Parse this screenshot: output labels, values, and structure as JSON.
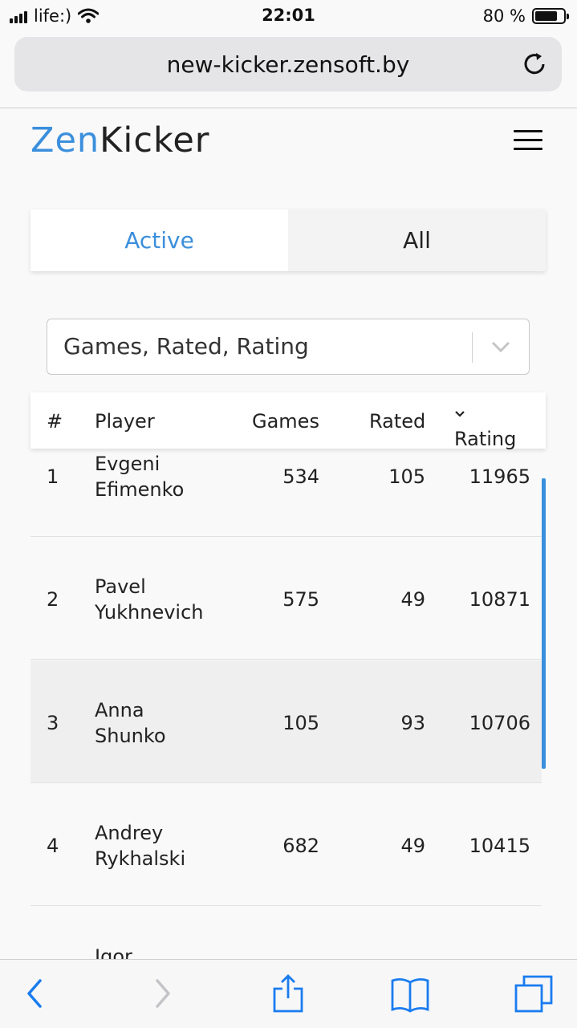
{
  "status_bar": {
    "carrier": "life:)",
    "time": "22:01",
    "battery": "80 %",
    "battery_level": 0.8
  },
  "browser": {
    "url": "new-kicker.zensoft.by"
  },
  "header": {
    "logo_part1": "Zen",
    "logo_part2": "Kicker"
  },
  "tabs": [
    {
      "label": "Active",
      "selected": true
    },
    {
      "label": "All",
      "selected": false
    }
  ],
  "columns_select": {
    "value": "Games, Rated, Rating"
  },
  "table": {
    "headers": {
      "num": "#",
      "player": "Player",
      "games": "Games",
      "rated": "Rated",
      "rating": "Rating"
    },
    "rows": [
      {
        "num": "1",
        "first": "Evgeni",
        "last": "Efimenko",
        "games": "534",
        "rated": "105",
        "rating": "11965"
      },
      {
        "num": "2",
        "first": "Pavel",
        "last": "Yukhnevich",
        "games": "575",
        "rated": "49",
        "rating": "10871"
      },
      {
        "num": "3",
        "first": "Anna",
        "last": "Shunko",
        "games": "105",
        "rated": "93",
        "rating": "10706"
      },
      {
        "num": "4",
        "first": "Andrey",
        "last": "Rykhalski",
        "games": "682",
        "rated": "49",
        "rating": "10415"
      },
      {
        "num": "",
        "first": "Igor",
        "last": "",
        "games": "",
        "rated": "",
        "rating": ""
      }
    ]
  },
  "colors": {
    "accent": "#3b8fdc",
    "ios_blue": "#1a7cf0"
  }
}
